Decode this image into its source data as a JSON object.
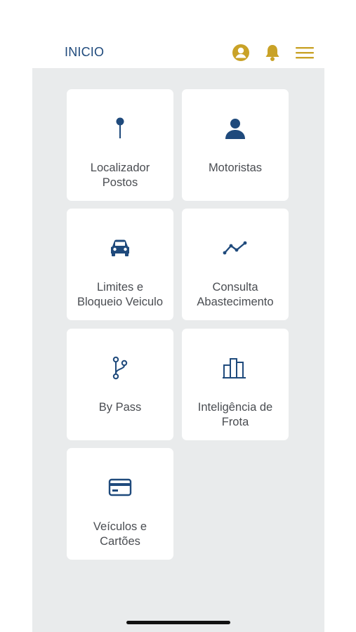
{
  "header": {
    "title": "INICIO",
    "icons": [
      "user-icon",
      "bell-icon",
      "menu-icon"
    ],
    "accent_color": "#c9a227"
  },
  "menu": {
    "icon_color": "#1f4a7c",
    "items": [
      {
        "label": "Localizador\nPostos",
        "icon": "pin-icon"
      },
      {
        "label": "Motoristas",
        "icon": "person-icon"
      },
      {
        "label": "Limites e\nBloqueio Veiculo",
        "icon": "car-icon"
      },
      {
        "label": "Consulta\nAbastecimento",
        "icon": "trend-icon"
      },
      {
        "label": "By Pass",
        "icon": "branch-icon"
      },
      {
        "label": "Inteligência de\nFrota",
        "icon": "bar-chart-icon"
      },
      {
        "label": "Veículos e\nCartões",
        "icon": "card-icon"
      }
    ]
  }
}
